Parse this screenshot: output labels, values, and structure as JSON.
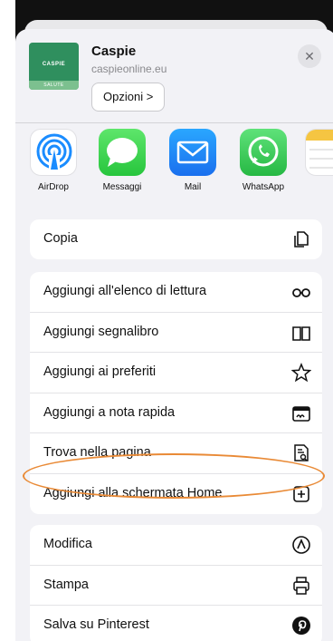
{
  "share_sheet": {
    "app": {
      "name": "Caspie",
      "url": "caspieonline.eu",
      "options_label": "Opzioni >",
      "logo_text": "CASPIE",
      "logo_subtext": "SALUTE",
      "brand_color": "#2f8f5e"
    },
    "close_label": "✕",
    "apps": [
      {
        "label": "AirDrop",
        "icon": "airdrop-icon"
      },
      {
        "label": "Messaggi",
        "icon": "messages-icon"
      },
      {
        "label": "Mail",
        "icon": "mail-icon"
      },
      {
        "label": "WhatsApp",
        "icon": "whatsapp-icon"
      }
    ],
    "group1": [
      {
        "label": "Copia",
        "icon": "copy-icon"
      }
    ],
    "group2": [
      {
        "label": "Aggiungi all'elenco di lettura",
        "icon": "glasses-icon"
      },
      {
        "label": "Aggiungi segnalibro",
        "icon": "book-icon"
      },
      {
        "label": "Aggiungi ai preferiti",
        "icon": "star-icon"
      },
      {
        "label": "Aggiungi a nota rapida",
        "icon": "quick-note-icon"
      },
      {
        "label": "Trova nella pagina",
        "icon": "find-in-page-icon"
      },
      {
        "label": "Aggiungi alla schermata Home",
        "icon": "add-square-icon"
      }
    ],
    "group3": [
      {
        "label": "Modifica",
        "icon": "markup-icon"
      },
      {
        "label": "Stampa",
        "icon": "printer-icon"
      },
      {
        "label": "Salva su Pinterest",
        "icon": "pinterest-icon"
      }
    ],
    "highlight_color": "#e98a36"
  }
}
